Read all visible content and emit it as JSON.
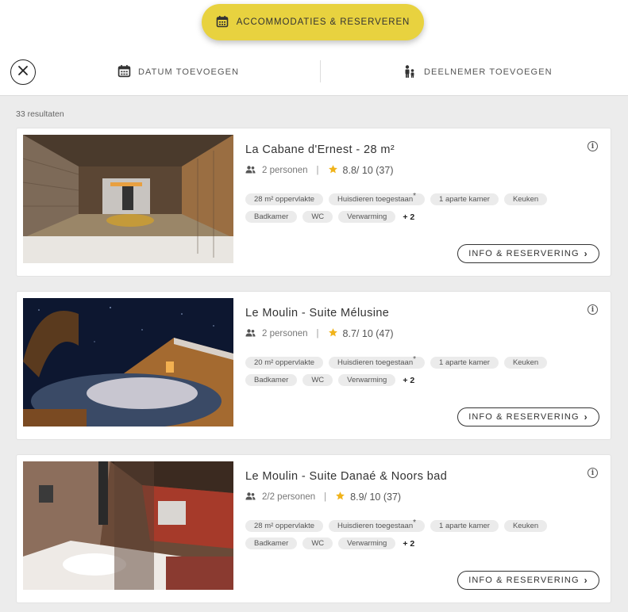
{
  "header": {
    "accommodations_button": "ACCOMMODATIES & RESERVEREN",
    "date_filter": "DATUM TOEVOEGEN",
    "participant_filter": "DEELNEMER TOEVOEGEN"
  },
  "results": {
    "count_label": "33 resultaten",
    "items": [
      {
        "title": "La Cabane d'Ernest - 28 m²",
        "persons": "2 personen",
        "rating": "8.8/ 10 (37)",
        "tags_row1": [
          "28 m² oppervlakte",
          "Huisdieren toegestaan",
          "1 aparte kamer",
          "Keuken"
        ],
        "tags_row2": [
          "Badkamer",
          "WC",
          "Verwarming"
        ],
        "pets_marker": "*",
        "more": "+ 2",
        "cta": "INFO & RESERVERING"
      },
      {
        "title": "Le Moulin - Suite Mélusine",
        "persons": "2 personen",
        "rating": "8.7/ 10 (47)",
        "tags_row1": [
          "20 m² oppervlakte",
          "Huisdieren toegestaan",
          "1 aparte kamer",
          "Keuken"
        ],
        "tags_row2": [
          "Badkamer",
          "WC",
          "Verwarming"
        ],
        "pets_marker": "*",
        "more": "+ 2",
        "cta": "INFO & RESERVERING"
      },
      {
        "title": "Le Moulin - Suite Danaé & Noors bad",
        "persons": "2/2 personen",
        "rating": "8.9/ 10 (37)",
        "tags_row1": [
          "28 m² oppervlakte",
          "Huisdieren toegestaan",
          "1 aparte kamer",
          "Keuken"
        ],
        "tags_row2": [
          "Badkamer",
          "WC",
          "Verwarming"
        ],
        "pets_marker": "*",
        "more": "+ 2",
        "cta": "INFO & RESERVERING"
      }
    ]
  },
  "colors": {
    "accent_yellow": "#e8d23f",
    "star": "#f0b31a"
  },
  "icons": {
    "accommodations": "calendar-icon",
    "close": "close-icon",
    "date": "calendar-icon",
    "participant": "people-icon",
    "persons": "people-icon",
    "rating": "star-icon",
    "info": "info-icon",
    "cta": "chevron-right-icon"
  }
}
